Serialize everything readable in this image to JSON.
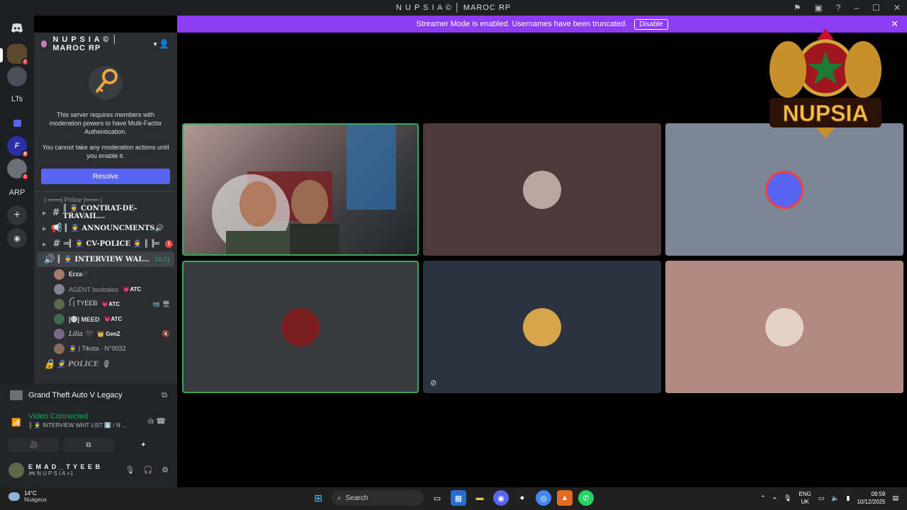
{
  "window": {
    "title": "N U P S I A © │ MAROC RP"
  },
  "banner": {
    "text": "Streamer Mode is enabled. Usernames have been truncated.",
    "disable_label": "Disable"
  },
  "guilds": {
    "lts_label": "LTs",
    "arp_label": "ARP",
    "badge_1": "7",
    "badge_2": "5",
    "badge_3": "1"
  },
  "server": {
    "name": "N U P S I A © │ MAROC RP",
    "mfa_text_1": "This server requires members with moderation powers to have Multi-Factor Authentication.",
    "mfa_text_2": "You cannot take any moderation actions until you enable it.",
    "resolve_label": "Resolve",
    "category": "| ═══| Police |═══ |",
    "channels": [
      {
        "name": "║ 👮 CONTRAT-DE-TRAVAIL...",
        "type": "text"
      },
      {
        "name": "║ 👮 ANNOUNCMENTS🔊",
        "type": "announce"
      },
      {
        "name": "═╣ 👮 CV-POLICE 👮 ║ ╠═",
        "type": "text",
        "count": "1"
      }
    ],
    "active_voice": {
      "name": "║ 👮 INTERVIEW WAI...",
      "time": "34:41"
    },
    "members": [
      {
        "name": "Erza♡",
        "tag": ""
      },
      {
        "name": "AGENT boobaloo",
        "tag": "💗ATC"
      },
      {
        "name": "ꪶ | TYEEB",
        "tag": "💗ATC"
      },
      {
        "name": "[🅜] MEED",
        "tag": "💗ATC"
      },
      {
        "name": "Lilia 🖤",
        "tag": "👑 GenZ"
      },
      {
        "name": "👮 | Tikota - N°0032",
        "tag": ""
      }
    ],
    "locked_channel": "👮 POLICE 🎙"
  },
  "voice_panel": {
    "game": "Grand Theft Auto V Legacy",
    "status": "Video Connected",
    "channel": "║ 👮 INTERVIEW WAIT LIST ⬇️ / N ..."
  },
  "user": {
    "name": "E M A D _ T Y E E B",
    "status": "🎮 N U P S I A +1"
  },
  "logo": {
    "text": "NUPSIA"
  },
  "taskbar": {
    "temp": "14°C",
    "weather": "Nuageux",
    "search": "Search",
    "lang_1": "ENG",
    "lang_2": "UK",
    "time": "09:59",
    "date": "10/12/2025"
  },
  "colors": {
    "accent": "#5865f2",
    "banner": "#8c3cf2",
    "voice_green": "#23a55a",
    "tile_border": "#3ba55c"
  }
}
